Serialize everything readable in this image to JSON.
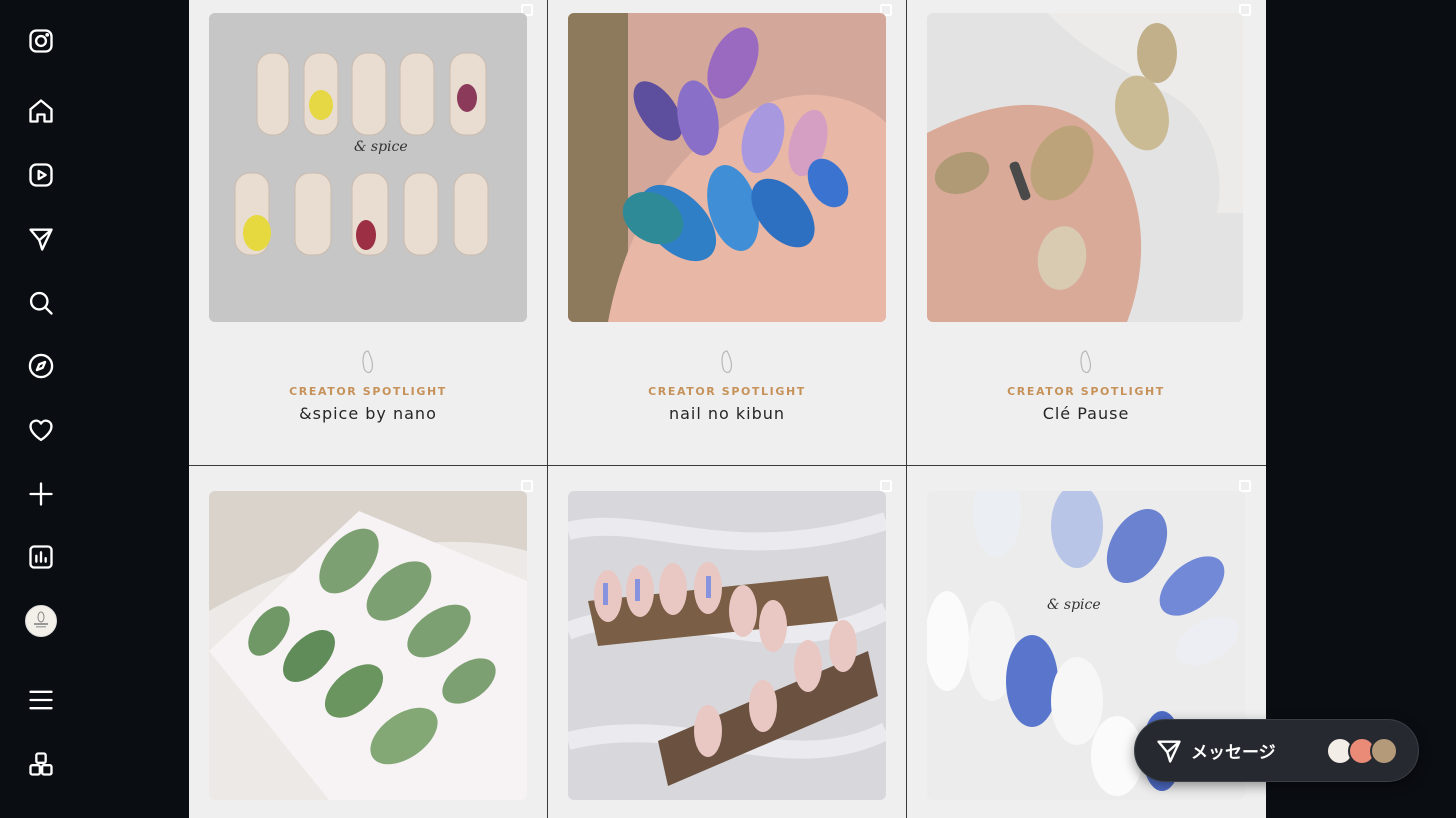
{
  "sidebar": {
    "items": [
      {
        "name": "instagram-logo-icon"
      },
      {
        "name": "home-icon"
      },
      {
        "name": "reels-icon"
      },
      {
        "name": "direct-icon"
      },
      {
        "name": "search-icon"
      },
      {
        "name": "explore-icon"
      },
      {
        "name": "notifications-heart-icon"
      },
      {
        "name": "create-plus-icon"
      },
      {
        "name": "insights-icon"
      },
      {
        "name": "profile-avatar"
      },
      {
        "name": "menu-icon"
      },
      {
        "name": "more-apps-icon"
      }
    ]
  },
  "grid": {
    "posts": [
      {
        "type": "spotlight",
        "kicker": "CREATOR SPOTLIGHT",
        "name": "&spice by nano",
        "image": "nail-tips-lemon-grape"
      },
      {
        "type": "spotlight",
        "kicker": "CREATOR SPOTLIGHT",
        "name": "nail no kibun",
        "image": "nail-purple-blue-sky"
      },
      {
        "type": "spotlight",
        "kicker": "CREATOR SPOTLIGHT",
        "name": "Clé Pause",
        "image": "nail-gold-marble"
      },
      {
        "type": "photo",
        "image": "nail-tips-green-cat-eye"
      },
      {
        "type": "photo",
        "image": "nail-tips-pink-chrome"
      },
      {
        "type": "photo",
        "image": "nail-tips-blue-white-spice"
      }
    ]
  },
  "messages": {
    "label": "メッセージ"
  },
  "colors": {
    "sidebar_bg": "#0a0d12",
    "grid_bg": "#efefef",
    "kicker": "#c6925a",
    "pill_bg": "#262a30"
  }
}
